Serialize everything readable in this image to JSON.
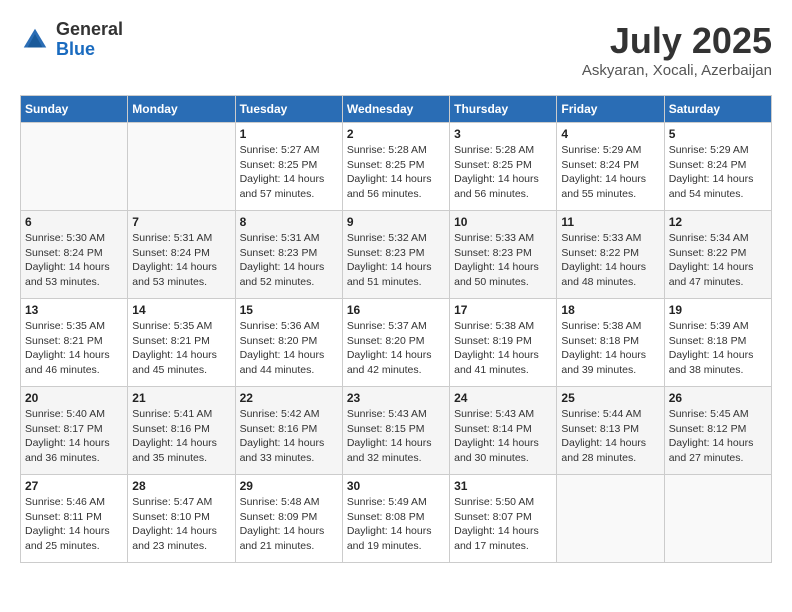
{
  "logo": {
    "general": "General",
    "blue": "Blue"
  },
  "header": {
    "month": "July 2025",
    "location": "Askyaran, Xocali, Azerbaijan"
  },
  "weekdays": [
    "Sunday",
    "Monday",
    "Tuesday",
    "Wednesday",
    "Thursday",
    "Friday",
    "Saturday"
  ],
  "weeks": [
    [
      {
        "day": "",
        "sunrise": "",
        "sunset": "",
        "daylight": ""
      },
      {
        "day": "",
        "sunrise": "",
        "sunset": "",
        "daylight": ""
      },
      {
        "day": "1",
        "sunrise": "Sunrise: 5:27 AM",
        "sunset": "Sunset: 8:25 PM",
        "daylight": "Daylight: 14 hours and 57 minutes."
      },
      {
        "day": "2",
        "sunrise": "Sunrise: 5:28 AM",
        "sunset": "Sunset: 8:25 PM",
        "daylight": "Daylight: 14 hours and 56 minutes."
      },
      {
        "day": "3",
        "sunrise": "Sunrise: 5:28 AM",
        "sunset": "Sunset: 8:25 PM",
        "daylight": "Daylight: 14 hours and 56 minutes."
      },
      {
        "day": "4",
        "sunrise": "Sunrise: 5:29 AM",
        "sunset": "Sunset: 8:24 PM",
        "daylight": "Daylight: 14 hours and 55 minutes."
      },
      {
        "day": "5",
        "sunrise": "Sunrise: 5:29 AM",
        "sunset": "Sunset: 8:24 PM",
        "daylight": "Daylight: 14 hours and 54 minutes."
      }
    ],
    [
      {
        "day": "6",
        "sunrise": "Sunrise: 5:30 AM",
        "sunset": "Sunset: 8:24 PM",
        "daylight": "Daylight: 14 hours and 53 minutes."
      },
      {
        "day": "7",
        "sunrise": "Sunrise: 5:31 AM",
        "sunset": "Sunset: 8:24 PM",
        "daylight": "Daylight: 14 hours and 53 minutes."
      },
      {
        "day": "8",
        "sunrise": "Sunrise: 5:31 AM",
        "sunset": "Sunset: 8:23 PM",
        "daylight": "Daylight: 14 hours and 52 minutes."
      },
      {
        "day": "9",
        "sunrise": "Sunrise: 5:32 AM",
        "sunset": "Sunset: 8:23 PM",
        "daylight": "Daylight: 14 hours and 51 minutes."
      },
      {
        "day": "10",
        "sunrise": "Sunrise: 5:33 AM",
        "sunset": "Sunset: 8:23 PM",
        "daylight": "Daylight: 14 hours and 50 minutes."
      },
      {
        "day": "11",
        "sunrise": "Sunrise: 5:33 AM",
        "sunset": "Sunset: 8:22 PM",
        "daylight": "Daylight: 14 hours and 48 minutes."
      },
      {
        "day": "12",
        "sunrise": "Sunrise: 5:34 AM",
        "sunset": "Sunset: 8:22 PM",
        "daylight": "Daylight: 14 hours and 47 minutes."
      }
    ],
    [
      {
        "day": "13",
        "sunrise": "Sunrise: 5:35 AM",
        "sunset": "Sunset: 8:21 PM",
        "daylight": "Daylight: 14 hours and 46 minutes."
      },
      {
        "day": "14",
        "sunrise": "Sunrise: 5:35 AM",
        "sunset": "Sunset: 8:21 PM",
        "daylight": "Daylight: 14 hours and 45 minutes."
      },
      {
        "day": "15",
        "sunrise": "Sunrise: 5:36 AM",
        "sunset": "Sunset: 8:20 PM",
        "daylight": "Daylight: 14 hours and 44 minutes."
      },
      {
        "day": "16",
        "sunrise": "Sunrise: 5:37 AM",
        "sunset": "Sunset: 8:20 PM",
        "daylight": "Daylight: 14 hours and 42 minutes."
      },
      {
        "day": "17",
        "sunrise": "Sunrise: 5:38 AM",
        "sunset": "Sunset: 8:19 PM",
        "daylight": "Daylight: 14 hours and 41 minutes."
      },
      {
        "day": "18",
        "sunrise": "Sunrise: 5:38 AM",
        "sunset": "Sunset: 8:18 PM",
        "daylight": "Daylight: 14 hours and 39 minutes."
      },
      {
        "day": "19",
        "sunrise": "Sunrise: 5:39 AM",
        "sunset": "Sunset: 8:18 PM",
        "daylight": "Daylight: 14 hours and 38 minutes."
      }
    ],
    [
      {
        "day": "20",
        "sunrise": "Sunrise: 5:40 AM",
        "sunset": "Sunset: 8:17 PM",
        "daylight": "Daylight: 14 hours and 36 minutes."
      },
      {
        "day": "21",
        "sunrise": "Sunrise: 5:41 AM",
        "sunset": "Sunset: 8:16 PM",
        "daylight": "Daylight: 14 hours and 35 minutes."
      },
      {
        "day": "22",
        "sunrise": "Sunrise: 5:42 AM",
        "sunset": "Sunset: 8:16 PM",
        "daylight": "Daylight: 14 hours and 33 minutes."
      },
      {
        "day": "23",
        "sunrise": "Sunrise: 5:43 AM",
        "sunset": "Sunset: 8:15 PM",
        "daylight": "Daylight: 14 hours and 32 minutes."
      },
      {
        "day": "24",
        "sunrise": "Sunrise: 5:43 AM",
        "sunset": "Sunset: 8:14 PM",
        "daylight": "Daylight: 14 hours and 30 minutes."
      },
      {
        "day": "25",
        "sunrise": "Sunrise: 5:44 AM",
        "sunset": "Sunset: 8:13 PM",
        "daylight": "Daylight: 14 hours and 28 minutes."
      },
      {
        "day": "26",
        "sunrise": "Sunrise: 5:45 AM",
        "sunset": "Sunset: 8:12 PM",
        "daylight": "Daylight: 14 hours and 27 minutes."
      }
    ],
    [
      {
        "day": "27",
        "sunrise": "Sunrise: 5:46 AM",
        "sunset": "Sunset: 8:11 PM",
        "daylight": "Daylight: 14 hours and 25 minutes."
      },
      {
        "day": "28",
        "sunrise": "Sunrise: 5:47 AM",
        "sunset": "Sunset: 8:10 PM",
        "daylight": "Daylight: 14 hours and 23 minutes."
      },
      {
        "day": "29",
        "sunrise": "Sunrise: 5:48 AM",
        "sunset": "Sunset: 8:09 PM",
        "daylight": "Daylight: 14 hours and 21 minutes."
      },
      {
        "day": "30",
        "sunrise": "Sunrise: 5:49 AM",
        "sunset": "Sunset: 8:08 PM",
        "daylight": "Daylight: 14 hours and 19 minutes."
      },
      {
        "day": "31",
        "sunrise": "Sunrise: 5:50 AM",
        "sunset": "Sunset: 8:07 PM",
        "daylight": "Daylight: 14 hours and 17 minutes."
      },
      {
        "day": "",
        "sunrise": "",
        "sunset": "",
        "daylight": ""
      },
      {
        "day": "",
        "sunrise": "",
        "sunset": "",
        "daylight": ""
      }
    ]
  ]
}
